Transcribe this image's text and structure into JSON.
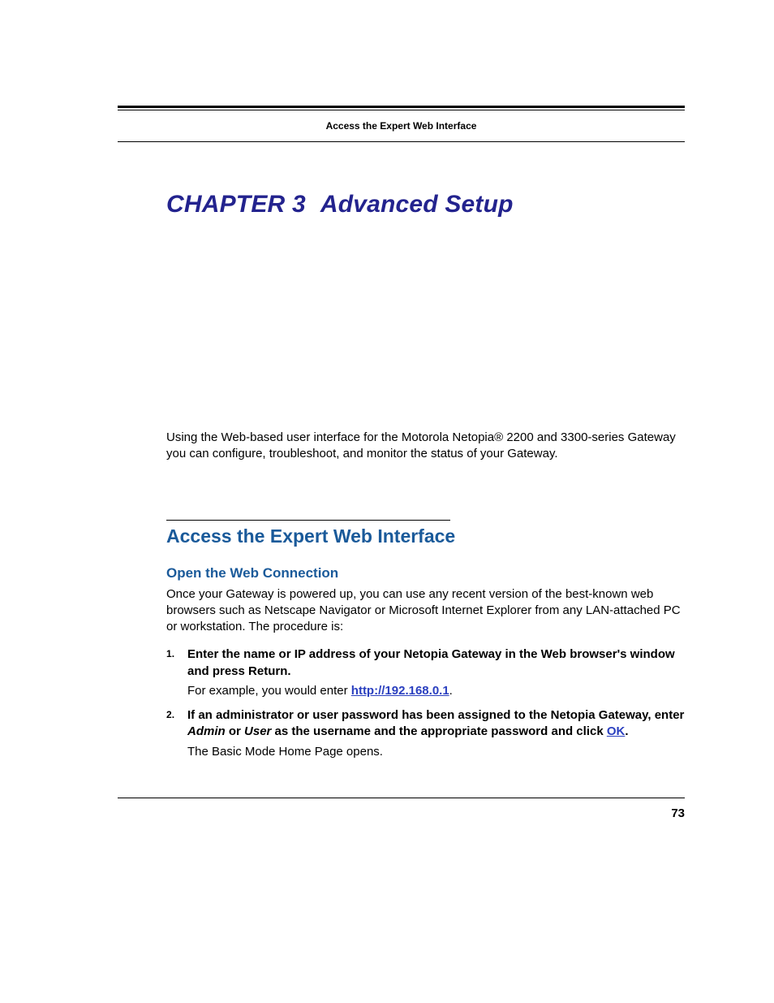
{
  "runningHead": "Access the Expert Web Interface",
  "chapter": {
    "label": "CHAPTER 3",
    "title": "Advanced Setup"
  },
  "intro": "Using the Web-based user interface for the Motorola Netopia® 2200 and 3300-series Gateway you can configure, troubleshoot, and monitor the status of your Gateway.",
  "section": {
    "heading": "Access the Expert Web Interface",
    "subheading": "Open the Web Connection",
    "body": "Once your Gateway is powered up, you can use any recent version of the best-known web browsers such as Netscape Navigator or Microsoft Internet Explorer from any LAN-attached PC or workstation. The procedure is:",
    "steps": [
      {
        "main": "Enter the name or IP address of your Netopia Gateway in the Web browser's window and press Return.",
        "sub_prefix": "For example, you would enter ",
        "link": "http://192.168.0.1",
        "sub_suffix": "."
      },
      {
        "main_prefix": "If an administrator or user password has been assigned to the Netopia Gateway, enter ",
        "ital1": "Admin",
        "mid1": " or ",
        "ital2": "User",
        "mid2": " as the username and the appropriate password and click ",
        "link": "OK",
        "main_suffix": ".",
        "sub": "The Basic Mode Home Page opens."
      }
    ]
  },
  "pageNumber": "73"
}
